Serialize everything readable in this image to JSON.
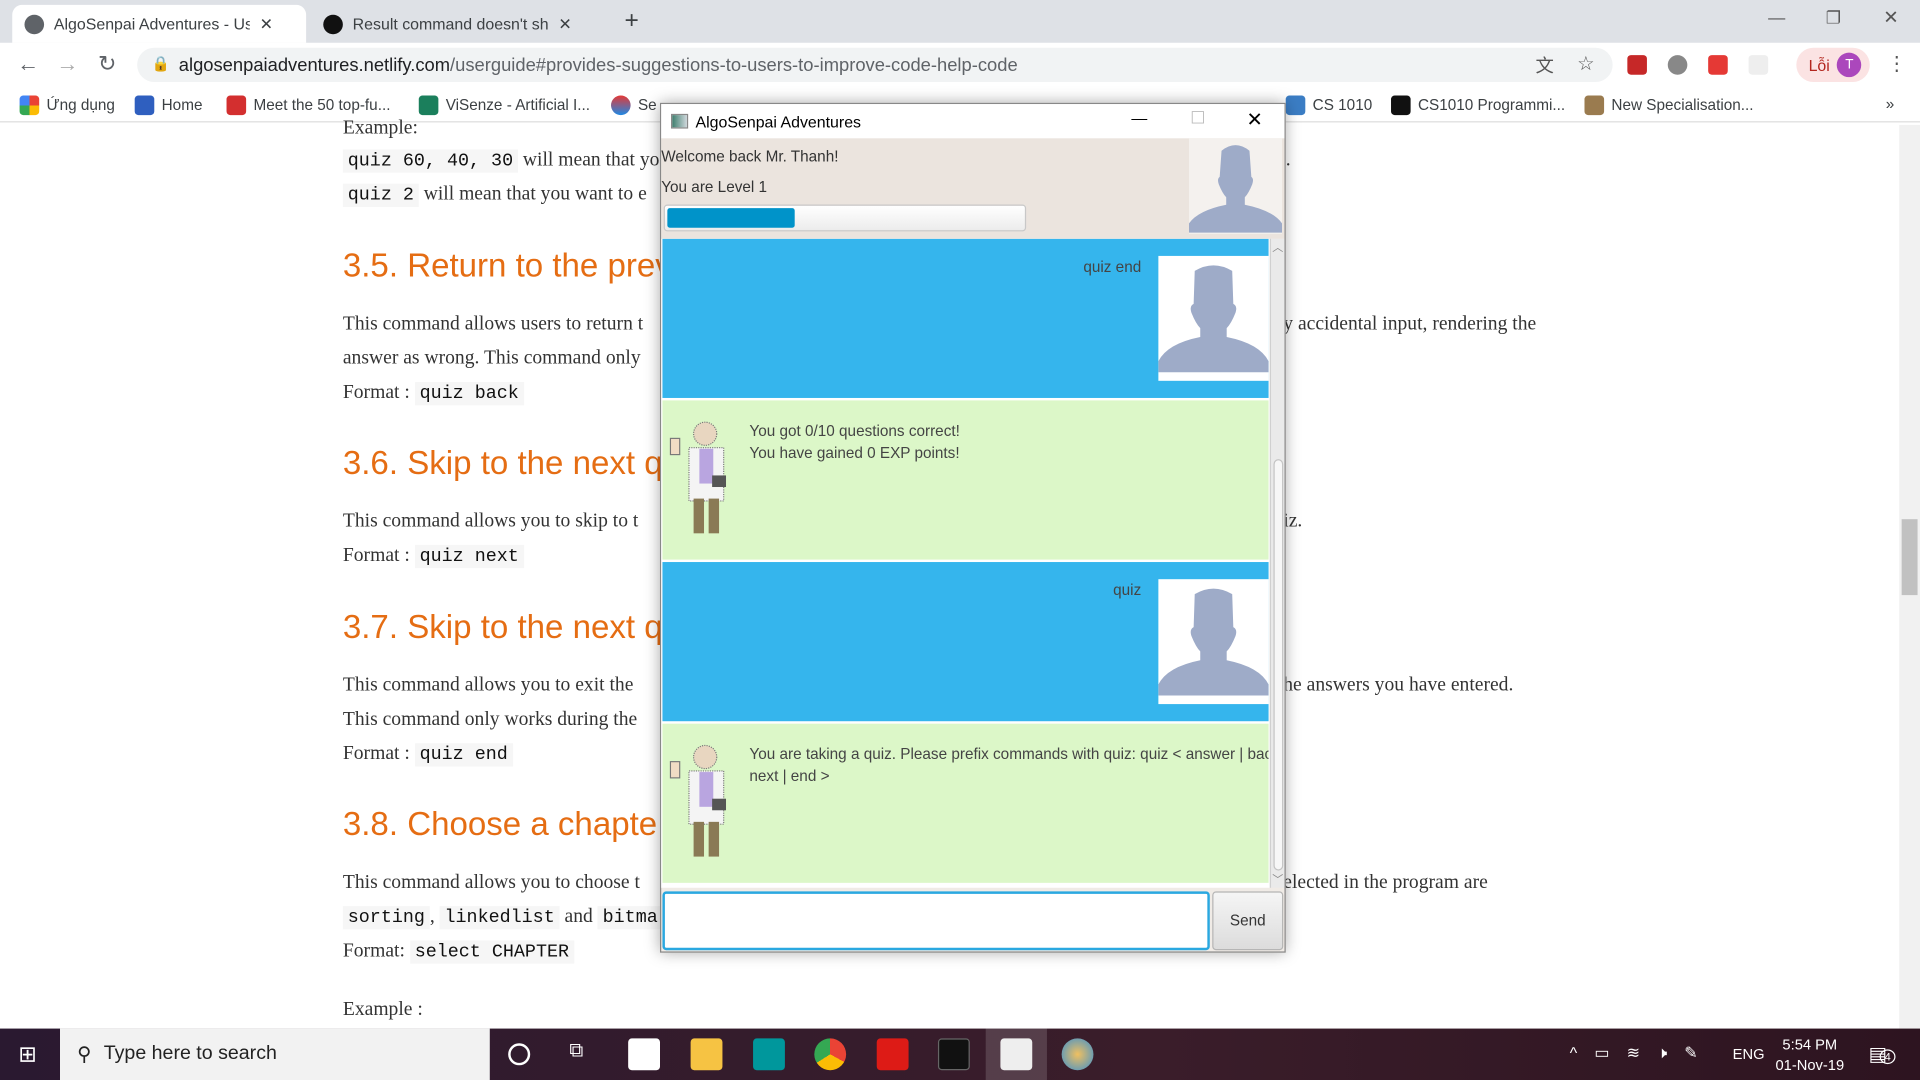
{
  "browser": {
    "tabs": [
      {
        "title": "AlgoSenpai Adventures - User Guide"
      },
      {
        "title": "Result command doesn't show result"
      }
    ],
    "new_tab": "+",
    "url_host": "algosenpaiadventures.netlify.com",
    "url_path": "/userguide#provides-suggestions-to-users-to-improve-code-help-code",
    "profile_label": "Lỗi",
    "profile_initial": "T",
    "bookmarks": [
      "Ứng dụng",
      "Home",
      "Meet the 50 top-fu...",
      "ViSenze - Artificial I...",
      "Se",
      "CS 1010",
      "CS1010 Programmi...",
      "New Specialisation..."
    ],
    "more": "»"
  },
  "doc": {
    "example_top": "Example:",
    "line1_code": "quiz 60, 40, 30",
    "line1_text": " will mean that yo",
    "line2_code": "quiz 2",
    "line2_text": " will mean that you want to e",
    "line1_right": ".",
    "h35": "3.5. Return to the prev",
    "p35a": "This command allows users to return t",
    "p35a_right": "y accidental input, rendering the",
    "p35b": "answer as wrong. This command only",
    "format_label": "Format : ",
    "f35": "quiz back",
    "h36": "3.6. Skip to the next q",
    "p36": "This command allows you to skip to t",
    "p36_right": "iz.",
    "f36": "quiz next",
    "h37": "3.7. Skip to the next q",
    "p37a": "This command allows you to exit the",
    "p37a_right": "he answers you have entered.",
    "p37b": "This command only works during the",
    "f37": "quiz end",
    "h38": "3.8. Choose a chapte",
    "p38a": "This command allows you to choose t",
    "p38a_right": "elected in the program are",
    "c38a": "sorting",
    "c38b": "linkedlist",
    "and": " and ",
    "c38c": "bitma",
    "comma": ", ",
    "format2_label": "Format: ",
    "f38": "select CHAPTER",
    "example_bottom": "Example :"
  },
  "app": {
    "title": "AlgoSenpai Adventures",
    "welcome": "Welcome back Mr. Thanh!",
    "level": "You are Level 1",
    "progress_percent": 36,
    "accent": "#0093c9",
    "messages": [
      {
        "from": "user",
        "text": "quiz end"
      },
      {
        "from": "bot",
        "line1": "You got 0/10 questions correct!",
        "line2": "You have gained 0 EXP points!"
      },
      {
        "from": "user",
        "text": "quiz"
      },
      {
        "from": "bot",
        "line1": "You are taking a quiz. Please prefix commands with quiz: quiz   < answer | back |",
        "line2": "next | end >"
      }
    ],
    "input_value": "",
    "send_label": "Send",
    "colors": {
      "user_bubble": "#35b5ed",
      "bot_bubble": "#dcf7c8"
    }
  },
  "taskbar": {
    "search_placeholder": "Type here to search",
    "time": "5:54 PM",
    "date": "01-Nov-19",
    "lang": "ENG",
    "notifications": "4"
  }
}
